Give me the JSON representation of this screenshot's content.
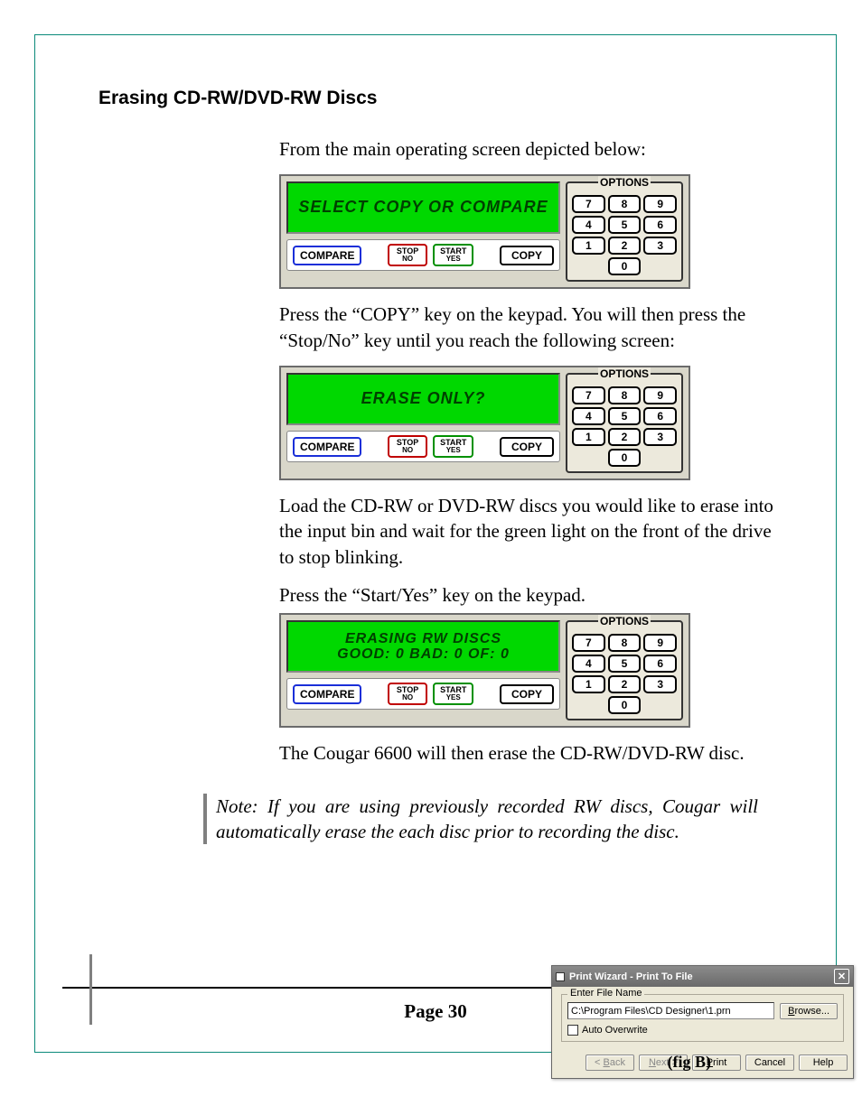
{
  "section_title": "Erasing CD-RW/DVD-RW Discs",
  "para1": "From the main operating screen depicted below:",
  "para2": "Press the “COPY” key on the keypad. You will then press the “Stop/No” key until you reach the following screen:",
  "para3": "Load the CD-RW or DVD-RW discs you would like to erase into the input bin and wait for the green light on the front of the drive to stop blinking.",
  "para4": "Press the “Start/Yes” key on the keypad.",
  "para5": "The Cougar 6600 will then erase the CD-RW/DVD-RW disc.",
  "note": "Note: If you are using previously recorded RW discs, Cougar will automatically erase the each disc prior to recording the disc.",
  "page_number": "Page 30",
  "lcd1_line1": "SELECT COPY OR COMPARE",
  "lcd2_line1": "ERASE ONLY?",
  "lcd3_line1": "ERASING RW DISCS",
  "lcd3_line2": "GOOD: 0   BAD: 0   OF: 0",
  "options_label": "OPTIONS",
  "btn_compare": "COMPARE",
  "btn_stop": "STOP",
  "btn_stop_sub": "NO",
  "btn_start": "START",
  "btn_start_sub": "YES",
  "btn_copy": "COPY",
  "keys": [
    "7",
    "8",
    "9",
    "4",
    "5",
    "6",
    "1",
    "2",
    "3",
    "0"
  ],
  "dialog": {
    "title": "Print Wizard - Print To File",
    "group_label": "Enter File Name",
    "filepath": "C:\\Program Files\\CD Designer\\1.prn",
    "browse": "Browse...",
    "auto_overwrite": "Auto Overwrite",
    "back": "Back",
    "next": "Next",
    "print": "Print",
    "cancel": "Cancel",
    "help": "Help"
  },
  "fig_caption": "(fig B)"
}
